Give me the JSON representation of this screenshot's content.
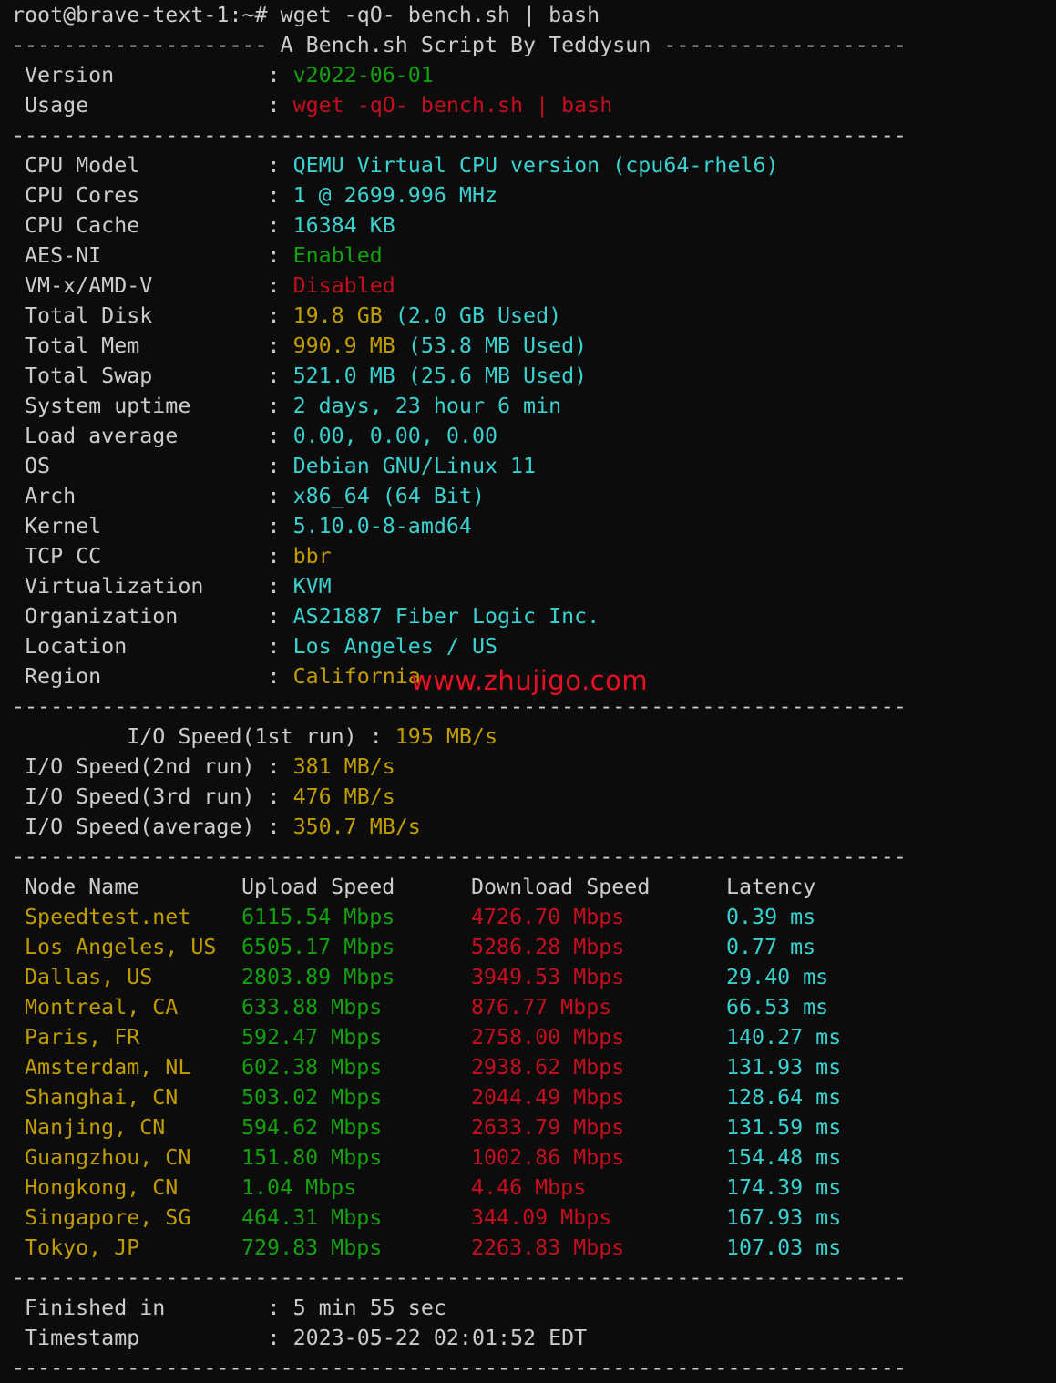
{
  "colors": {
    "background": "#0c0c0c",
    "foreground": "#cccccc",
    "green": "#13a10e",
    "red": "#c50f1f",
    "cyan": "#3ad1d1",
    "yellow": "#c19c00",
    "watermark": "#e81123"
  },
  "prompt": "root@brave-text-1:~# wget -qO- bench.sh | bash",
  "header_line": "-------------------- A Bench.sh Script By Teddysun -------------------",
  "separator": "----------------------------------------------------------------------",
  "version": {
    "label": " Version            : ",
    "value": "v2022-06-01"
  },
  "usage": {
    "label": " Usage              : ",
    "value": "wget -qO- bench.sh | bash"
  },
  "sysinfo": [
    {
      "label": " CPU Model          : ",
      "value": "QEMU Virtual CPU version (cpu64-rhel6)",
      "color": "cyan"
    },
    {
      "label": " CPU Cores          : ",
      "value": "1 @ 2699.996 MHz",
      "color": "cyan"
    },
    {
      "label": " CPU Cache          : ",
      "value": "16384 KB",
      "color": "cyan"
    },
    {
      "label": " AES-NI             : ",
      "value": "Enabled",
      "color": "green"
    },
    {
      "label": " VM-x/AMD-V         : ",
      "value": "Disabled",
      "color": "red"
    },
    {
      "label": " Total Disk         : ",
      "value": "19.8 GB",
      "value2": " (2.0 GB Used)",
      "color": "yellow",
      "color2": "cyan"
    },
    {
      "label": " Total Mem          : ",
      "value": "990.9 MB",
      "value2": " (53.8 MB Used)",
      "color": "yellow",
      "color2": "cyan"
    },
    {
      "label": " Total Swap         : ",
      "value": "521.0 MB (25.6 MB Used)",
      "color": "cyan"
    },
    {
      "label": " System uptime      : ",
      "value": "2 days, 23 hour 6 min",
      "color": "cyan"
    },
    {
      "label": " Load average       : ",
      "value": "0.00, 0.00, 0.00",
      "color": "cyan"
    },
    {
      "label": " OS                 : ",
      "value": "Debian GNU/Linux 11",
      "color": "cyan"
    },
    {
      "label": " Arch               : ",
      "value": "x86_64 (64 Bit)",
      "color": "cyan"
    },
    {
      "label": " Kernel             : ",
      "value": "5.10.0-8-amd64",
      "color": "cyan"
    },
    {
      "label": " TCP CC             : ",
      "value": "bbr",
      "color": "yellow"
    },
    {
      "label": " Virtualization     : ",
      "value": "KVM",
      "color": "cyan"
    },
    {
      "label": " Organization       : ",
      "value": "AS21887 Fiber Logic Inc.",
      "color": "cyan"
    },
    {
      "label": " Location           : ",
      "value": "Los Angeles / US",
      "color": "cyan"
    },
    {
      "label": " Region             : ",
      "value": "California",
      "color": "yellow"
    }
  ],
  "watermark": "www.zhujigo.com",
  "io": [
    {
      "label": "         I/O Speed(1st run) : ",
      "value": "195 MB/s"
    },
    {
      "label": " I/O Speed(2nd run) : ",
      "value": "381 MB/s"
    },
    {
      "label": " I/O Speed(3rd run) : ",
      "value": "476 MB/s"
    },
    {
      "label": " I/O Speed(average) : ",
      "value": "350.7 MB/s"
    }
  ],
  "speed_headers": {
    "node": " Node Name",
    "upload": "Upload Speed",
    "download": "Download Speed",
    "latency": "Latency"
  },
  "speed_rows": [
    {
      "node": " Speedtest.net",
      "upload": "6115.54 Mbps",
      "download": "4726.70 Mbps",
      "latency": "0.39 ms"
    },
    {
      "node": " Los Angeles, US",
      "upload": "6505.17 Mbps",
      "download": "5286.28 Mbps",
      "latency": "0.77 ms"
    },
    {
      "node": " Dallas, US",
      "upload": "2803.89 Mbps",
      "download": "3949.53 Mbps",
      "latency": "29.40 ms"
    },
    {
      "node": " Montreal, CA",
      "upload": "633.88 Mbps",
      "download": "876.77 Mbps",
      "latency": "66.53 ms"
    },
    {
      "node": " Paris, FR",
      "upload": "592.47 Mbps",
      "download": "2758.00 Mbps",
      "latency": "140.27 ms"
    },
    {
      "node": " Amsterdam, NL",
      "upload": "602.38 Mbps",
      "download": "2938.62 Mbps",
      "latency": "131.93 ms"
    },
    {
      "node": " Shanghai, CN",
      "upload": "503.02 Mbps",
      "download": "2044.49 Mbps",
      "latency": "128.64 ms"
    },
    {
      "node": " Nanjing, CN",
      "upload": "594.62 Mbps",
      "download": "2633.79 Mbps",
      "latency": "131.59 ms"
    },
    {
      "node": " Guangzhou, CN",
      "upload": "151.80 Mbps",
      "download": "1002.86 Mbps",
      "latency": "154.48 ms"
    },
    {
      "node": " Hongkong, CN",
      "upload": "1.04 Mbps",
      "download": "4.46 Mbps",
      "latency": "174.39 ms"
    },
    {
      "node": " Singapore, SG",
      "upload": "464.31 Mbps",
      "download": "344.09 Mbps",
      "latency": "167.93 ms"
    },
    {
      "node": " Tokyo, JP",
      "upload": "729.83 Mbps",
      "download": "2263.83 Mbps",
      "latency": "107.03 ms"
    }
  ],
  "finished": {
    "label": " Finished in        : ",
    "value": "5 min 55 sec"
  },
  "timestamp": {
    "label": " Timestamp          : ",
    "value": "2023-05-22 02:01:52 EDT"
  }
}
